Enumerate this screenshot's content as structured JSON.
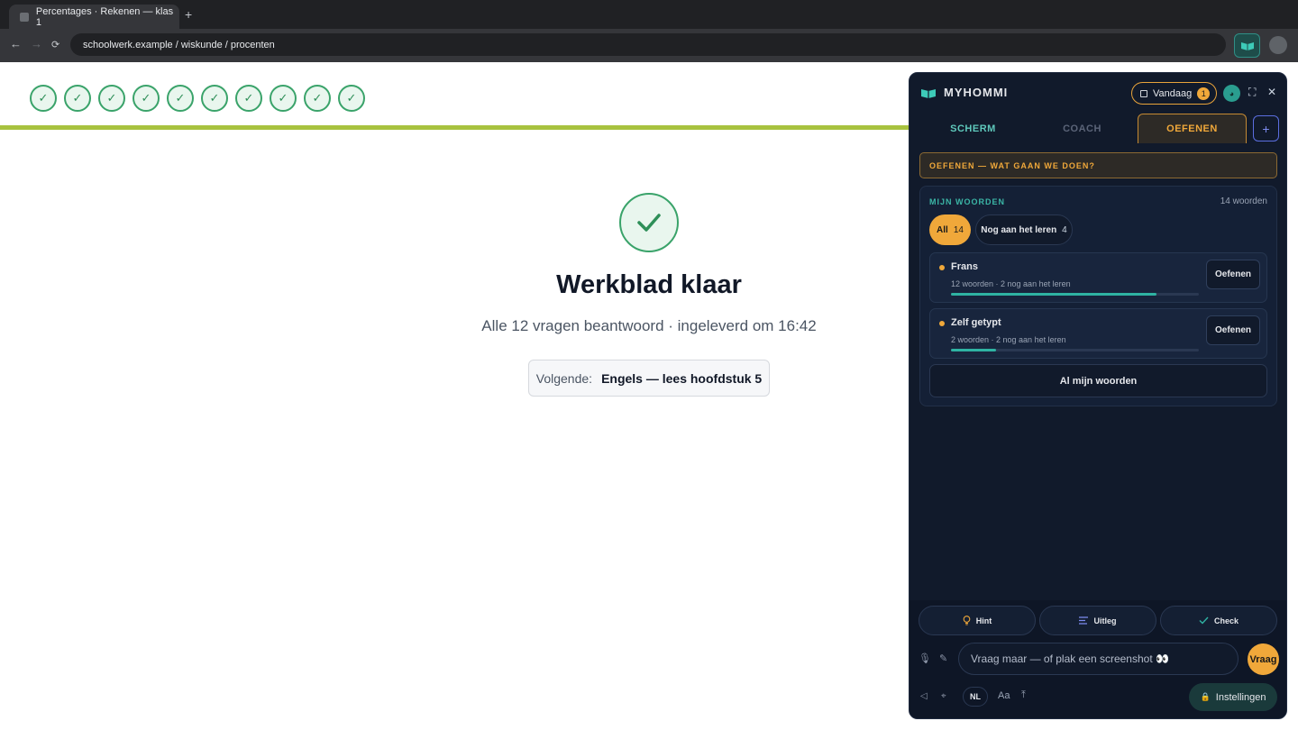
{
  "browser": {
    "tab_title": "Percentages · Rekenen — klas 1",
    "new_tab": "+",
    "url": "schoolwerk.example / wiskunde / procenten",
    "nav": {
      "back": "←",
      "forward": "→",
      "reload": "⟳"
    }
  },
  "page": {
    "progress": {
      "completed": 10,
      "total": 10,
      "mark": "✓"
    },
    "title": "Werkblad klaar",
    "subtitle": "Alle 12 vragen beantwoord · ingeleverd om 16:42",
    "next_label": "Volgende:",
    "next_value": "Engels — lees hoofdstuk 5"
  },
  "panel": {
    "brand": "MYHOMMI",
    "today_label": "Vandaag",
    "today_count": "1",
    "tabs": [
      {
        "label": "SCHERM"
      },
      {
        "label": "COACH"
      },
      {
        "label": "OEFENEN"
      }
    ],
    "add_tab": "+",
    "section_banner": "OEFENEN — WAT GAAN WE DOEN?",
    "words": {
      "title": "MIJN WOORDEN",
      "count_label": "14 woorden",
      "filters": [
        {
          "label": "All",
          "count": "14"
        },
        {
          "label": "Nog aan het leren",
          "count": "4"
        }
      ],
      "items": [
        {
          "name": "Frans",
          "meta": "12 woorden · 2 nog aan het leren",
          "progress": 0.83,
          "button": "Oefenen"
        },
        {
          "name": "Zelf getypt",
          "meta": "2 woorden · 2 nog aan het leren",
          "progress": 0.18,
          "button": "Oefenen"
        }
      ],
      "all_button": "Al mijn woorden"
    },
    "actions": [
      {
        "label": "Hint",
        "icon": "lightbulb-icon"
      },
      {
        "label": "Uitleg",
        "icon": "lines-icon"
      },
      {
        "label": "Check",
        "icon": "check-icon"
      }
    ],
    "ask_placeholder": "Vraag maar — of plak een screenshot 👀",
    "ask_button": "Vraag",
    "language": "NL",
    "font_size": "Aa",
    "settings": "Instellingen"
  },
  "colors": {
    "accent": "#f0a83a",
    "teal": "#2fb3a3",
    "success": "#3aa36a",
    "lime": "#a8c23f",
    "panel_bg": "#111a2b"
  }
}
